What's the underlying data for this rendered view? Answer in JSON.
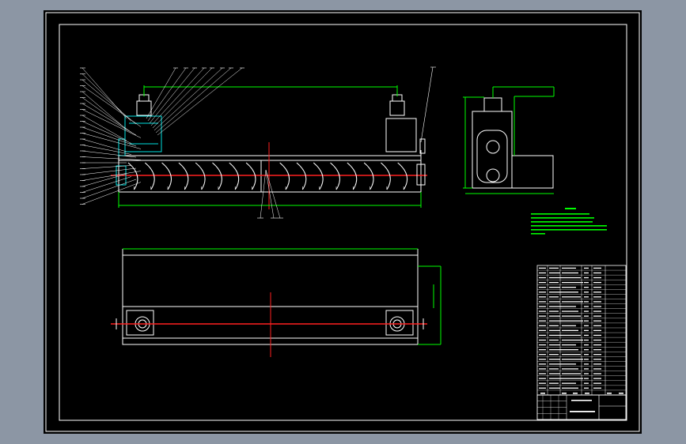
{
  "viewport": {
    "background": "#8c96a4",
    "sheet_background": "#000000"
  },
  "colors": {
    "frame": "#ffffff",
    "geometry": "#ffffff",
    "dimension": "#00ff00",
    "centerline": "#ff2020",
    "highlight": "#00e0e0",
    "leader": "#ffffff"
  },
  "views": {
    "front_view": {
      "motor_count": 2,
      "screw_flight_count": 17,
      "balloon_count_left": 24,
      "balloon_count_top": 8,
      "balloon_count_bottom": 3
    },
    "top_view": {
      "bearing_count": 2
    },
    "side_view": {
      "sprocket_count": 2
    }
  },
  "technical_requirements": {
    "line_count": 6
  },
  "parts_list": {
    "row_count": 27,
    "column_count": 6
  },
  "title_block": {
    "row_count": 3
  }
}
